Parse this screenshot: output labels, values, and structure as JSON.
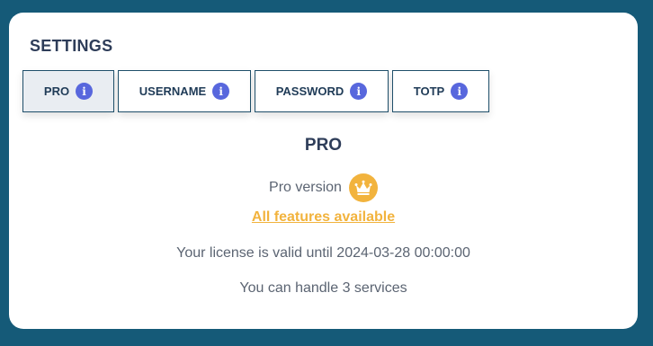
{
  "settings": {
    "title": "SETTINGS"
  },
  "tabs": [
    {
      "label": "PRO",
      "icon": "info-icon",
      "active": true
    },
    {
      "label": "USERNAME",
      "icon": "info-icon",
      "active": false
    },
    {
      "label": "PASSWORD",
      "icon": "info-icon",
      "active": false
    },
    {
      "label": "TOTP",
      "icon": "info-icon",
      "active": false
    }
  ],
  "pro_panel": {
    "heading": "PRO",
    "version_label": "Pro version",
    "version_icon": "crown-icon",
    "features_link": "All features available",
    "license_text": "Your license is valid until 2024-03-28 00:00:00",
    "services_text": "You can handle 3 services"
  },
  "colors": {
    "background": "#155a78",
    "info_icon": "#5867dd",
    "crown_badge": "#f2b33d",
    "link": "#f2b33d",
    "title": "#2e3d59"
  }
}
